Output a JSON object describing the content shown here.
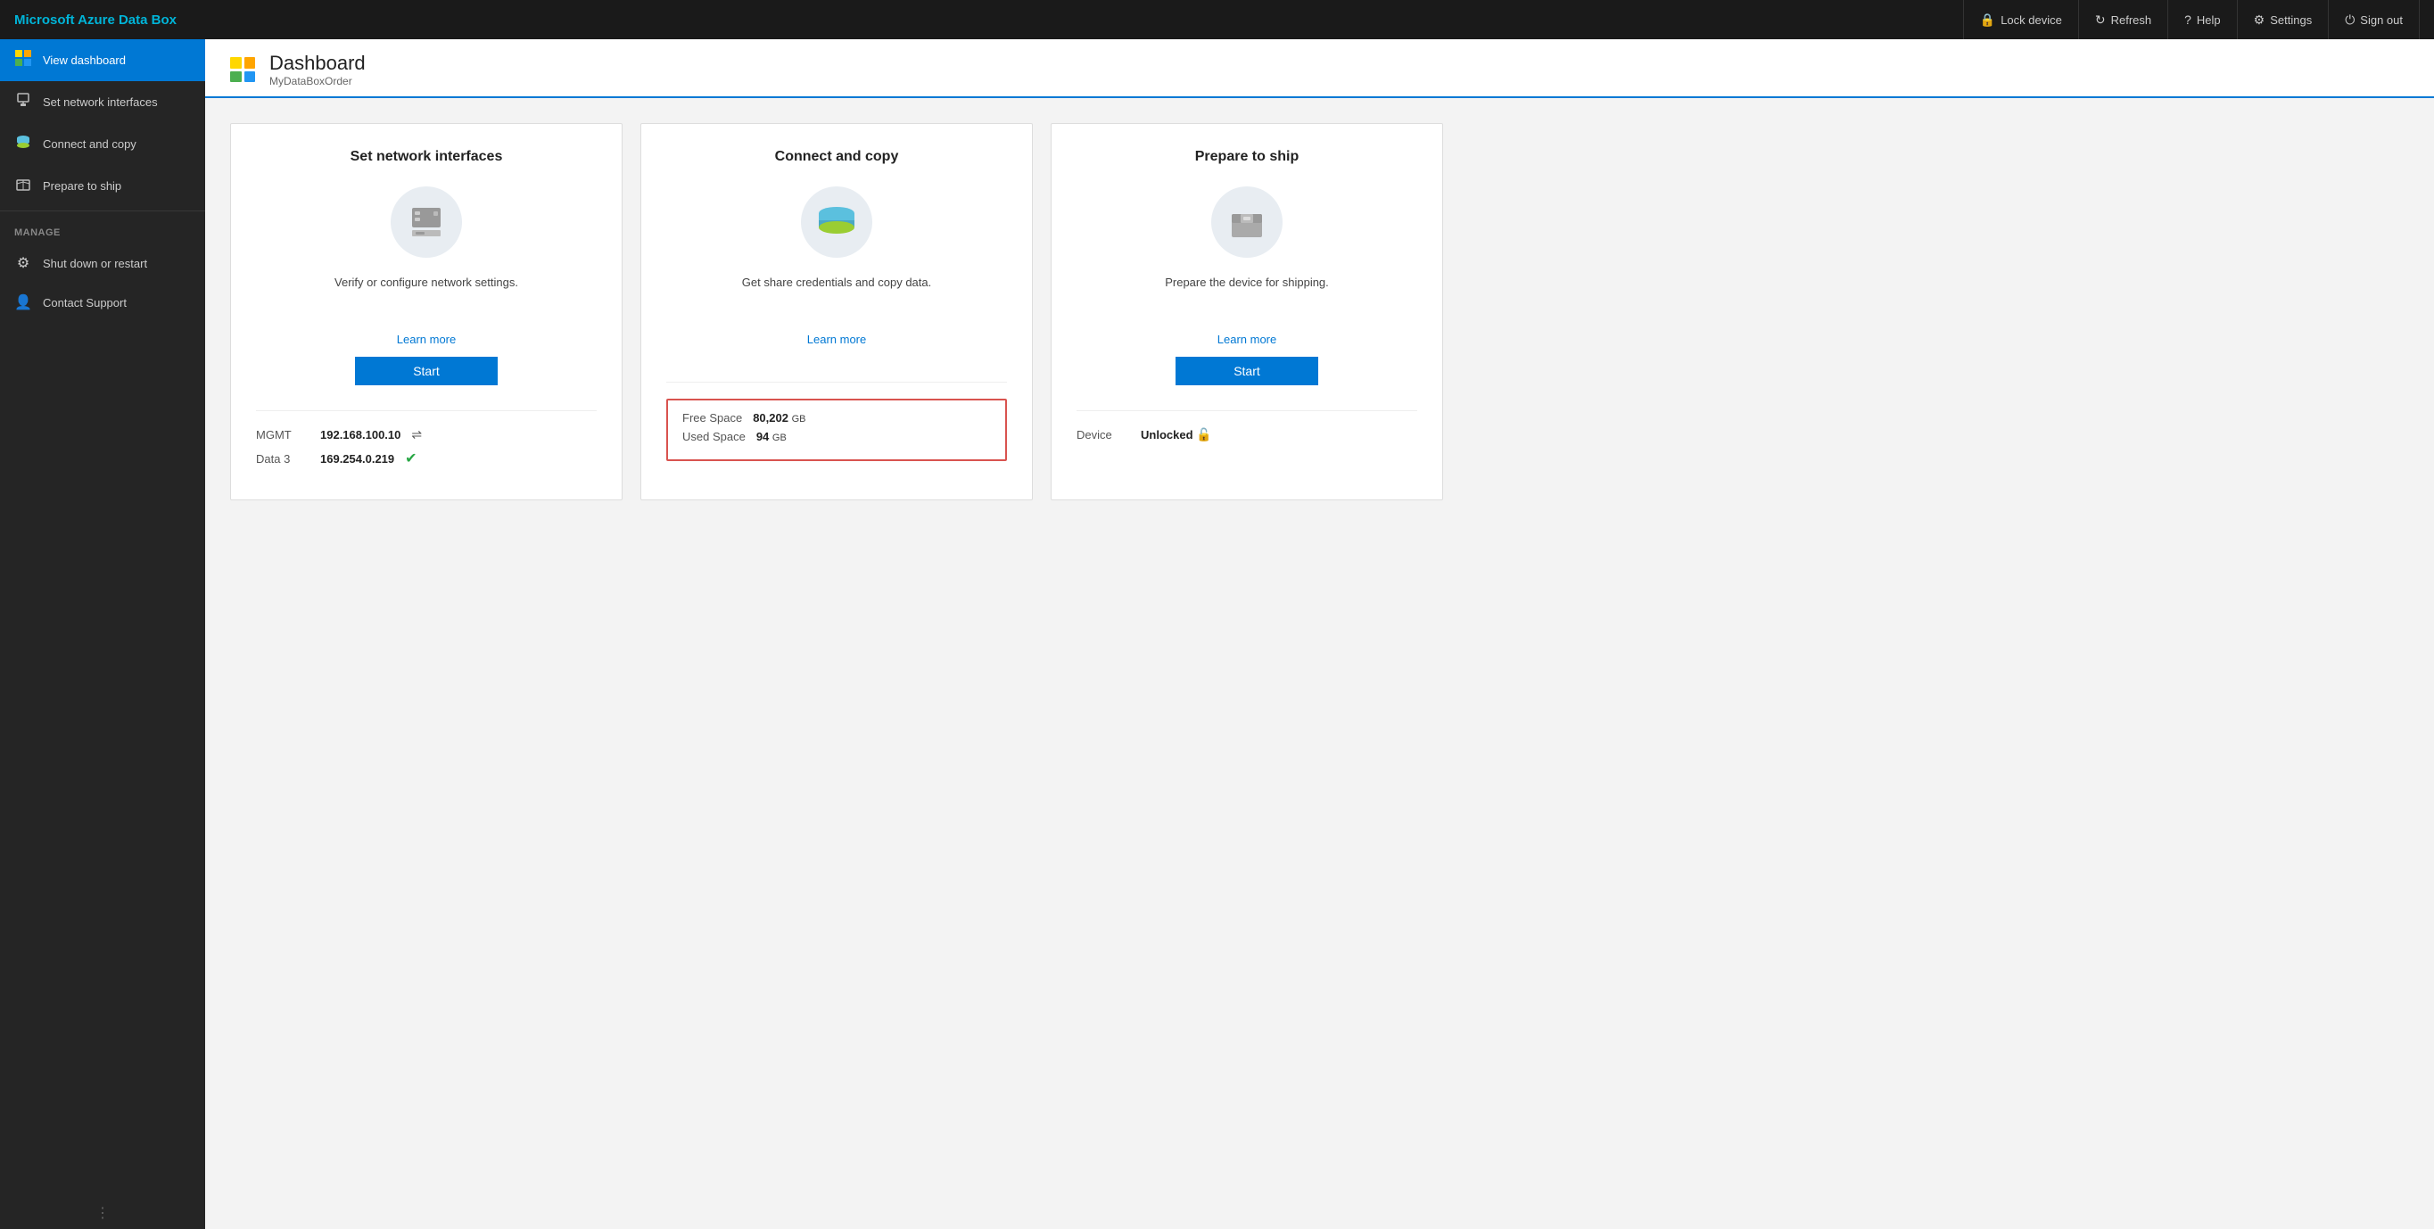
{
  "topbar": {
    "title": "Microsoft Azure Data Box",
    "buttons": [
      {
        "id": "lock-device",
        "label": "Lock device",
        "icon": "🔒"
      },
      {
        "id": "refresh",
        "label": "Refresh",
        "icon": "↻"
      },
      {
        "id": "help",
        "label": "Help",
        "icon": "?"
      },
      {
        "id": "settings",
        "label": "Settings",
        "icon": "⚙"
      },
      {
        "id": "sign-out",
        "label": "Sign out",
        "icon": "⏻"
      }
    ]
  },
  "sidebar": {
    "nav_items": [
      {
        "id": "view-dashboard",
        "label": "View dashboard",
        "icon": "▦",
        "active": true
      },
      {
        "id": "set-network-interfaces",
        "label": "Set network interfaces",
        "icon": "🖧",
        "active": false
      },
      {
        "id": "connect-and-copy",
        "label": "Connect and copy",
        "icon": "💾",
        "active": false
      },
      {
        "id": "prepare-to-ship",
        "label": "Prepare to ship",
        "icon": "📦",
        "active": false
      }
    ],
    "manage_label": "MANAGE",
    "manage_items": [
      {
        "id": "shut-down-or-restart",
        "label": "Shut down or restart",
        "icon": "⚙"
      },
      {
        "id": "contact-support",
        "label": "Contact Support",
        "icon": "👤"
      }
    ]
  },
  "page": {
    "title": "Dashboard",
    "subtitle": "MyDataBoxOrder"
  },
  "cards": [
    {
      "id": "set-network-interfaces",
      "title": "Set network interfaces",
      "description": "Verify or configure network settings.",
      "learn_more_label": "Learn more",
      "start_label": "Start",
      "footer": {
        "rows": [
          {
            "label": "MGMT",
            "value": "192.168.100.10",
            "unit": "",
            "status": "network"
          },
          {
            "label": "Data 3",
            "value": "169.254.0.219",
            "unit": "",
            "status": "connected"
          }
        ]
      }
    },
    {
      "id": "connect-and-copy",
      "title": "Connect and copy",
      "description": "Get share credentials and copy data.",
      "learn_more_label": "Learn more",
      "start_label": null,
      "footer": {
        "info_box": true,
        "rows": [
          {
            "label": "Free Space",
            "value": "80,202",
            "unit": "GB"
          },
          {
            "label": "Used Space",
            "value": "94",
            "unit": "GB"
          }
        ]
      }
    },
    {
      "id": "prepare-to-ship",
      "title": "Prepare to ship",
      "description": "Prepare the device for shipping.",
      "learn_more_label": "Learn more",
      "start_label": "Start",
      "footer": {
        "rows": [
          {
            "label": "Device",
            "value": "Unlocked",
            "unit": "",
            "status": "unlocked"
          }
        ]
      }
    }
  ]
}
